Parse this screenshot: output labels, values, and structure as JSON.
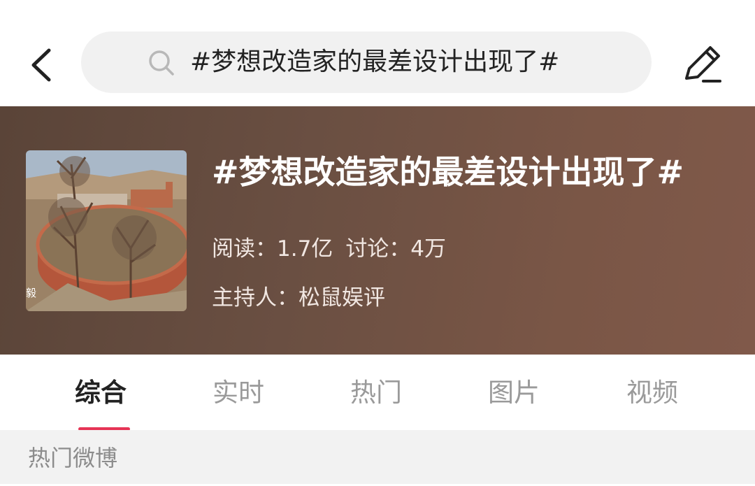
{
  "header": {
    "back_icon": "chevron-left-icon",
    "search_icon": "search-icon",
    "search_query": "#梦想改造家的最差设计出现了#",
    "edit_icon": "pencil-icon"
  },
  "topic": {
    "title": "#梦想改造家的最差设计出现了#",
    "reads_label": "阅读：1.7亿",
    "discussions_label": "讨论：4万",
    "host_label": "主持人：松鼠娱评",
    "cover_watermark": "毅",
    "banner_color": "#6a4f42"
  },
  "tabs": [
    {
      "label": "综合",
      "active": true
    },
    {
      "label": "实时",
      "active": false
    },
    {
      "label": "热门",
      "active": false
    },
    {
      "label": "图片",
      "active": false
    },
    {
      "label": "视频",
      "active": false
    }
  ],
  "accent_color": "#e63455",
  "section": {
    "title": "热门微博"
  }
}
